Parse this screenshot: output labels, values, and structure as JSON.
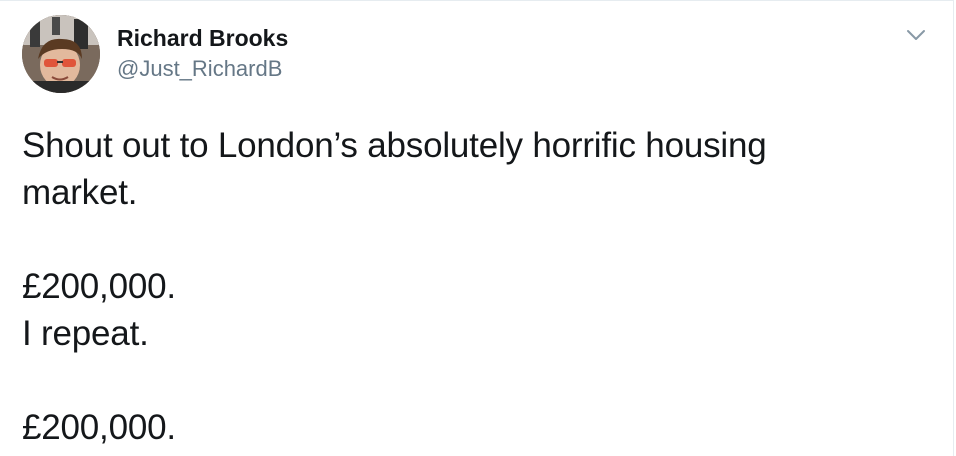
{
  "tweet": {
    "author": {
      "display_name": "Richard Brooks",
      "handle": "@Just_RichardB",
      "avatar_icon": "profile-photo"
    },
    "menu_icon": "chevron-down-icon",
    "text_lines": [
      "Shout out to London’s absolutely horrific housing",
      "market.",
      "£200,000.",
      "I repeat.",
      "£200,000."
    ]
  },
  "colors": {
    "name": "#14171a",
    "handle": "#657786",
    "caret": "#8899a6",
    "border": "#e6ecf0"
  }
}
